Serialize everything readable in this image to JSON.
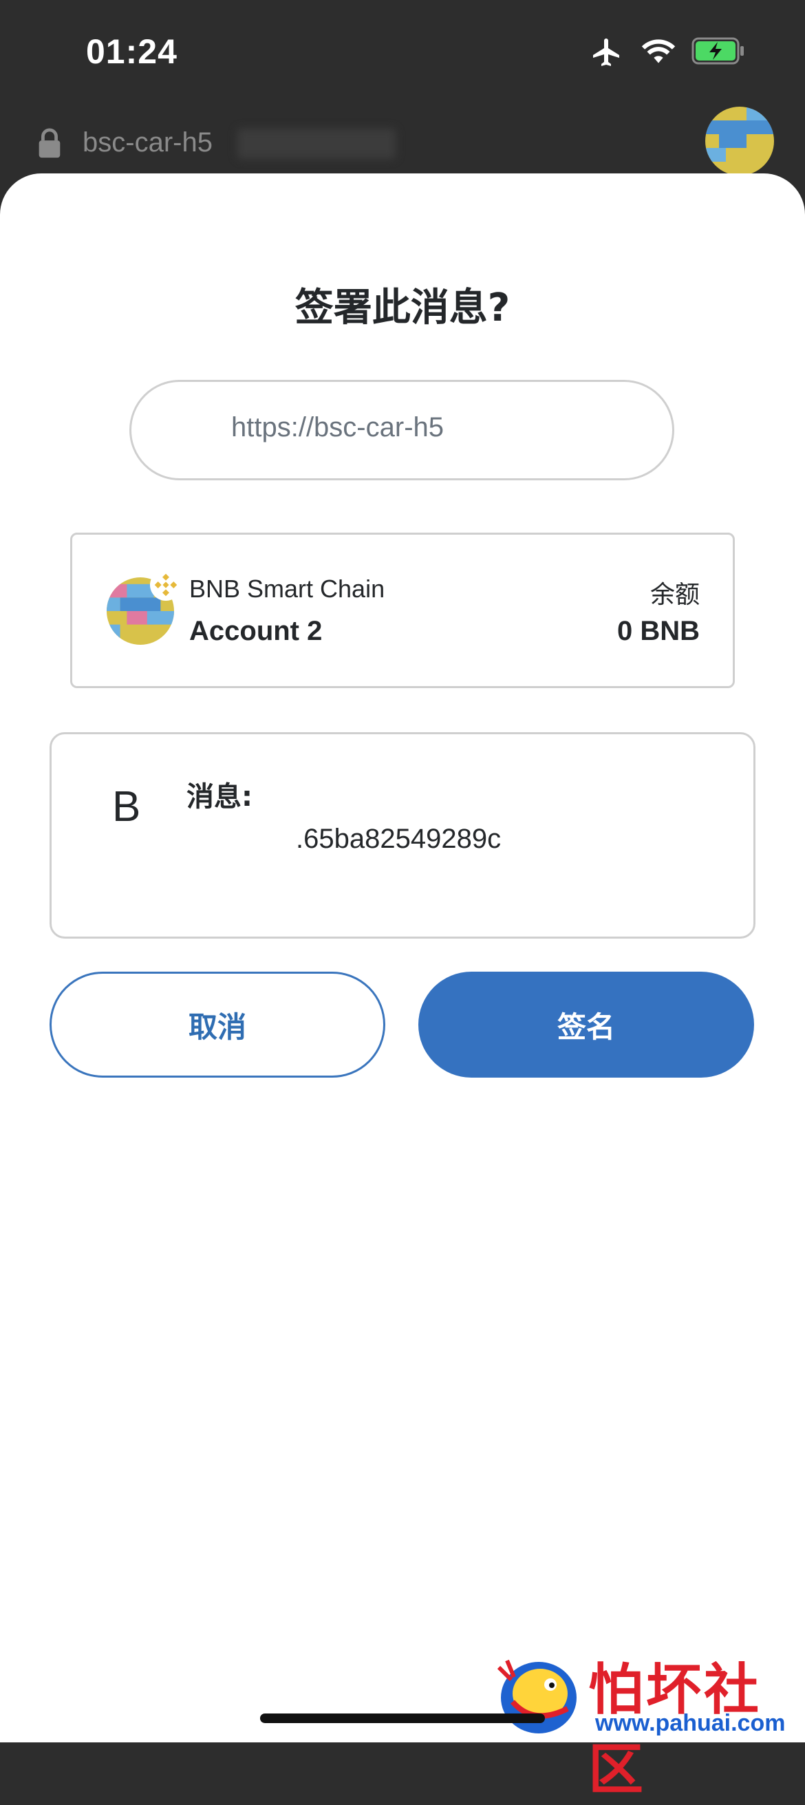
{
  "status_bar": {
    "time": "01:24"
  },
  "browser": {
    "url": "bsc-car-h5"
  },
  "dialog": {
    "title": "签署此消息?",
    "origin": "https://bsc-car-h5",
    "account": {
      "network": "BNB Smart Chain",
      "name": "Account 2",
      "balance_label": "余额",
      "balance_value": "0 BNB"
    },
    "message": {
      "initial": "B",
      "label": "消息:",
      "value": ".65ba82549289c"
    },
    "buttons": {
      "cancel": "取消",
      "sign": "签名"
    }
  },
  "watermark": {
    "title": "怕坏社区",
    "url": "www.pahuai.com",
    "logo": "fish-logo-icon"
  },
  "colors": {
    "primary": "#3572c0",
    "text": "#24272a",
    "border": "#cfcfcf"
  }
}
